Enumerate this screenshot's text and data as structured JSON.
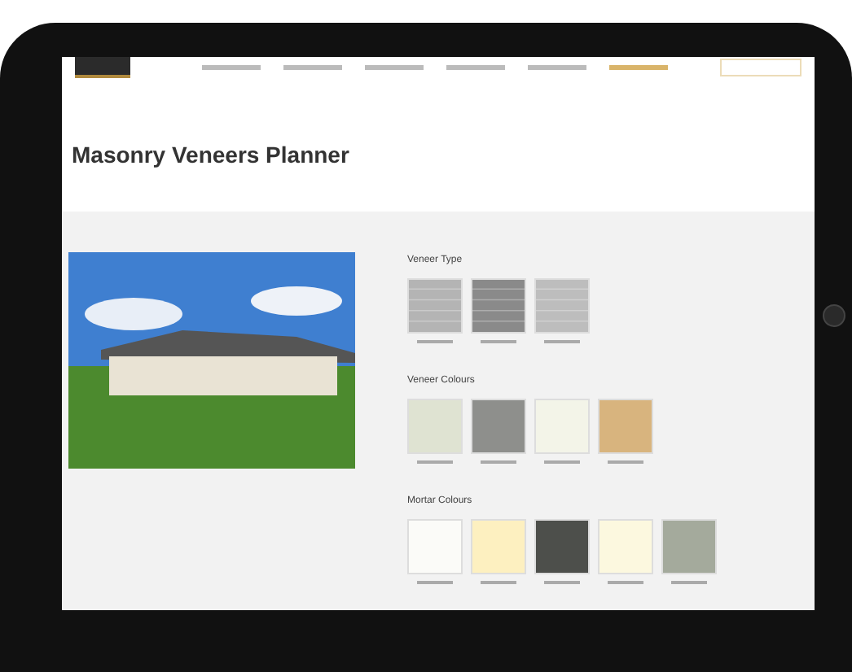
{
  "page": {
    "title": "Masonry Veneers Planner"
  },
  "sections": [
    {
      "heading": "Veneer Type",
      "kind": "texture",
      "swatches": [
        {
          "color": "#b4b4b4"
        },
        {
          "color": "#8a8a8a"
        },
        {
          "color": "#bdbdbd"
        }
      ]
    },
    {
      "heading": "Veneer Colours",
      "kind": "plain",
      "swatches": [
        {
          "color": "#dfe3d2"
        },
        {
          "color": "#8e8f8c"
        },
        {
          "color": "#f3f4e8"
        },
        {
          "color": "#d8b47e"
        }
      ]
    },
    {
      "heading": "Mortar Colours",
      "kind": "plain",
      "swatches": [
        {
          "color": "#fbfbf8"
        },
        {
          "color": "#fdf0c0"
        },
        {
          "color": "#4d4f4b"
        },
        {
          "color": "#fcf8df"
        },
        {
          "color": "#a4aa9c"
        }
      ]
    }
  ]
}
